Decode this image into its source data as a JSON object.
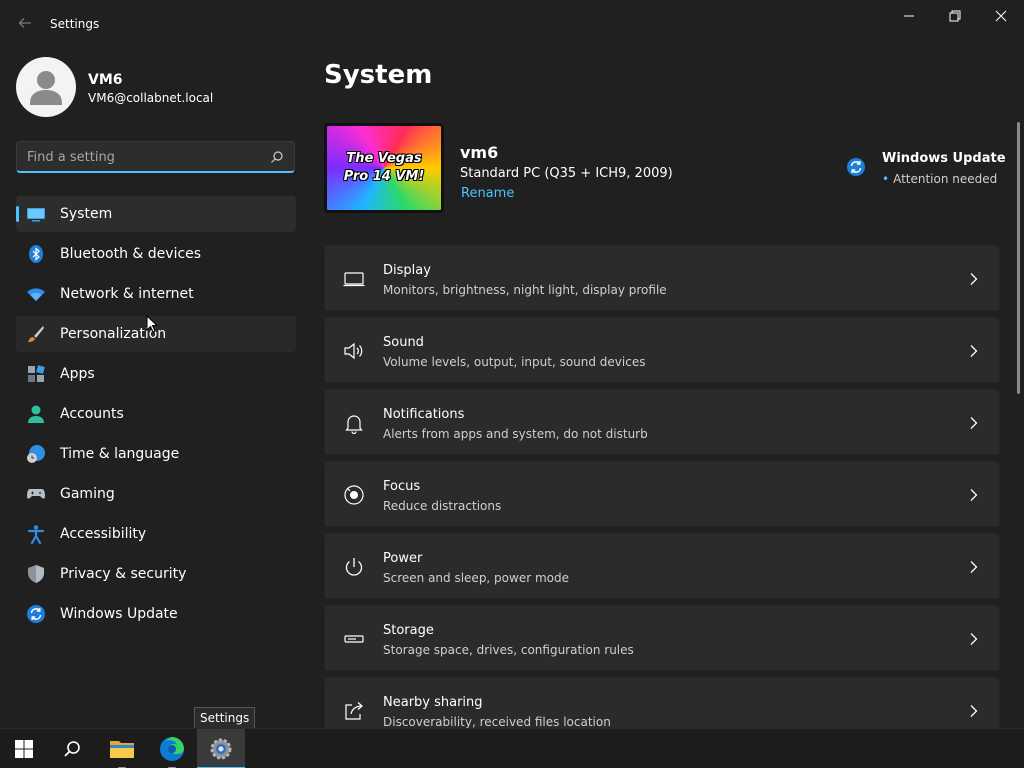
{
  "window": {
    "title": "Settings"
  },
  "profile": {
    "name": "VM6",
    "email": "VM6@collabnet.local"
  },
  "search": {
    "placeholder": "Find a setting"
  },
  "nav": {
    "items": [
      {
        "label": "System",
        "icon": "monitor-icon",
        "active": true
      },
      {
        "label": "Bluetooth & devices",
        "icon": "bluetooth-icon"
      },
      {
        "label": "Network & internet",
        "icon": "wifi-icon"
      },
      {
        "label": "Personalization",
        "icon": "paintbrush-icon"
      },
      {
        "label": "Apps",
        "icon": "apps-icon"
      },
      {
        "label": "Accounts",
        "icon": "person-icon"
      },
      {
        "label": "Time & language",
        "icon": "globe-clock-icon"
      },
      {
        "label": "Gaming",
        "icon": "gamepad-icon"
      },
      {
        "label": "Accessibility",
        "icon": "accessibility-icon"
      },
      {
        "label": "Privacy & security",
        "icon": "shield-icon"
      },
      {
        "label": "Windows Update",
        "icon": "sync-icon"
      }
    ]
  },
  "main": {
    "title": "System",
    "device": {
      "wallpaper_text_1": "The Vegas",
      "wallpaper_text_2": "Pro 14 VM!",
      "name": "vm6",
      "model": "Standard PC (Q35 + ICH9, 2009)",
      "rename_label": "Rename"
    },
    "windows_update": {
      "title": "Windows Update",
      "status": "Attention needed"
    },
    "cards": [
      {
        "title": "Display",
        "subtitle": "Monitors, brightness, night light, display profile",
        "icon": "display-icon"
      },
      {
        "title": "Sound",
        "subtitle": "Volume levels, output, input, sound devices",
        "icon": "speaker-icon"
      },
      {
        "title": "Notifications",
        "subtitle": "Alerts from apps and system, do not disturb",
        "icon": "bell-icon"
      },
      {
        "title": "Focus",
        "subtitle": "Reduce distractions",
        "icon": "focus-icon"
      },
      {
        "title": "Power",
        "subtitle": "Screen and sleep, power mode",
        "icon": "power-icon"
      },
      {
        "title": "Storage",
        "subtitle": "Storage space, drives, configuration rules",
        "icon": "storage-icon"
      },
      {
        "title": "Nearby sharing",
        "subtitle": "Discoverability, received files location",
        "icon": "share-icon"
      }
    ]
  },
  "taskbar": {
    "tooltip": "Settings"
  },
  "colors": {
    "accent": "#4cc2ff",
    "background": "#202020",
    "card": "#2b2b2b"
  }
}
